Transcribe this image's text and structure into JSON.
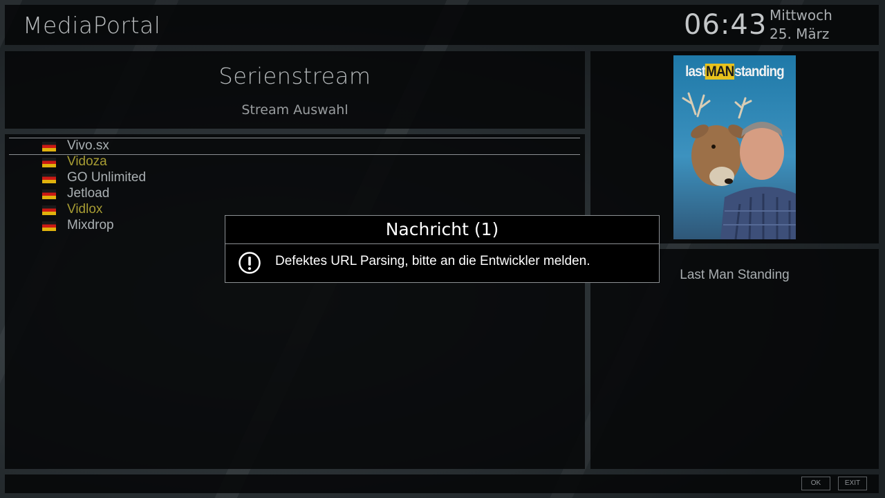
{
  "header": {
    "app_title": "MediaPortal",
    "clock": "06:43",
    "weekday": "Mittwoch",
    "date": "25. März"
  },
  "service": {
    "title": "Serienstream",
    "subtitle": "Stream Auswahl"
  },
  "streams": [
    {
      "label": "Vivo.sx",
      "style": "normal",
      "selected": true,
      "flag": "de-flag-icon"
    },
    {
      "label": "Vidoza",
      "style": "highlight",
      "selected": false,
      "flag": "de-flag-icon"
    },
    {
      "label": "GO Unlimited",
      "style": "normal",
      "selected": false,
      "flag": "de-flag-icon"
    },
    {
      "label": "Jetload",
      "style": "normal",
      "selected": false,
      "flag": "de-flag-icon"
    },
    {
      "label": "Vidlox",
      "style": "highlight",
      "selected": false,
      "flag": "de-flag-icon"
    },
    {
      "label": "Mixdrop",
      "style": "normal",
      "selected": false,
      "flag": "de-flag-icon"
    }
  ],
  "cover": {
    "title_part1": "last",
    "title_part2": "MAN",
    "title_part3": "standing"
  },
  "show_title": "Last Man Standing",
  "dialog": {
    "title": "Nachricht (1)",
    "message": "Defektes URL Parsing, bitte an die Entwickler melden.",
    "icon": "exclamation-icon"
  },
  "keys": {
    "ok": "OK",
    "exit": "EXIT"
  },
  "colors": {
    "highlight_text": "#a79c33",
    "normal_text": "#aab0b3",
    "dialog_border": "#8d9194"
  }
}
